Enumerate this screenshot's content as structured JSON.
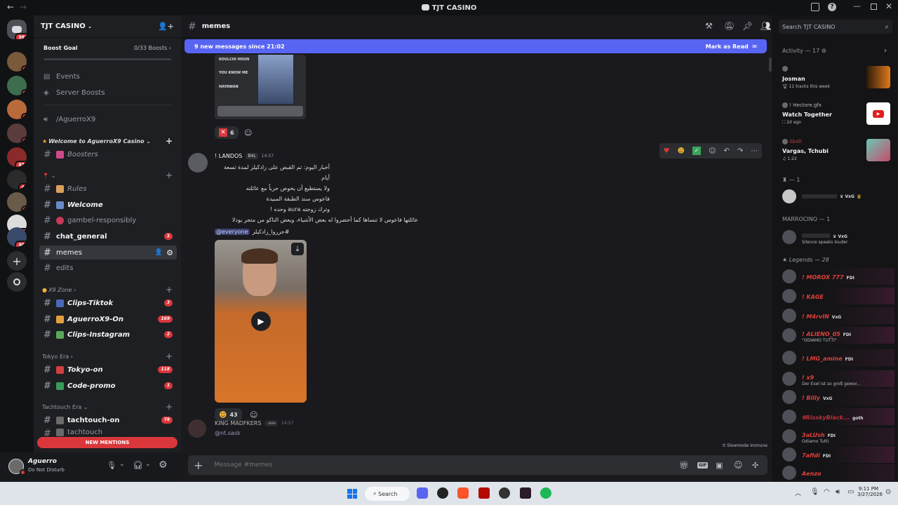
{
  "window": {
    "title": "TJT CASINO"
  },
  "guilds": [
    {
      "badge": "993",
      "color": "#4e5058"
    },
    {
      "badge": "1",
      "color": "#7a5a3a"
    },
    {
      "badge": "1",
      "color": "#3c6e4e"
    },
    {
      "badge": "2",
      "color": "#b86a3a"
    },
    {
      "badge": "3",
      "color": "#5a3c3c"
    },
    {
      "badge": "879",
      "color": "#8a2a2a"
    },
    {
      "badge": "43",
      "color": "#2a2a2a"
    },
    {
      "badge": "1",
      "color": "#6a5a4a"
    },
    {
      "badge": "411",
      "color": "#dcdcdc"
    },
    {
      "badge": "405",
      "color": "#3a4a6a"
    }
  ],
  "server": {
    "name": "TJT CASINO",
    "boost_goal": "Boost Goal",
    "boost_count": "0/33 Boosts"
  },
  "channels": {
    "events": "Events",
    "server_boosts": "Server Boosts",
    "voice": "/AguerroX9",
    "cat_welcome": "Welcome to AguerroX9 Casino",
    "boosters": "Boosters",
    "cat_small": "",
    "rules": "Rules",
    "welcome": "Welcome",
    "gambel": "gambel-responsibly",
    "chat_general": "chat_general",
    "chat_general_badge": "2",
    "memes": "memes",
    "edits": "edits",
    "cat_x9": "X9 Zone",
    "clips_tiktok": "Clips-Tiktok",
    "clips_tiktok_badge": "3",
    "aguerro_on": "AguerroX9-On",
    "aguerro_on_badge": "169",
    "clips_insta": "Clips-Instagram",
    "clips_insta_badge": "2",
    "cat_tokyo": "Tokyo Era",
    "tokyo_on": "Tokyo-on",
    "tokyo_on_badge": "118",
    "code_promo": "Code-promo",
    "code_promo_badge": "1",
    "cat_tacht": "Tachtouch Era",
    "tachtouch_on": "tachtouch-on",
    "tachtouch_on_badge": "78",
    "tachtouch": "tachtouch",
    "new_mentions": "NEW MENTIONS"
  },
  "user": {
    "name": "Aguerro",
    "status": "Do Not Disturb"
  },
  "chat": {
    "channel": "memes",
    "new_messages": "9 new messages since 21:02",
    "mark_read": "Mark as Read",
    "embed_lines": [
      "KOULCHI HOUN",
      "YOU KNOW ME",
      "HAYAWAN"
    ],
    "reaction1_count": "6",
    "msg1": {
      "author": "! LANDOS",
      "tag": "B4L",
      "time": "14:57",
      "lines": [
        "أخبار اليوم: تم القبض على زادكيلر لمدة تسعة أيام",
        "ولا يستطيع أن يخوض حرباً مع عائلته",
        "فاعوس سند الطبقة المبيدة",
        "وترك زوجته aura وحده !",
        "عائلتها فاعوس لا تنساها كما أحضروا له بعض الأشياء، ويعض الناكو من متجر يودلا"
      ],
      "mention": "@everyone",
      "hashtag": "#حرروا_زادكيلر",
      "reaction_count": "43"
    },
    "msg2": {
      "author": "KING MADFKERS",
      "tag": ".exe",
      "time": "14:57",
      "text": "@nt.sask"
    },
    "slowmode": "Slowmode Immune",
    "placeholder": "Message #memes"
  },
  "search": {
    "placeholder": "Search TJT CASINO"
  },
  "activity": {
    "header": "Activity — 17",
    "items": [
      {
        "name": "Josman",
        "sub": "11 tracks this week"
      },
      {
        "user": "! Hectore.gfx",
        "name": "Watch Together",
        "sub": "2d ago"
      },
      {
        "user": "Sb4ll",
        "name": "Vargas, Tchubi",
        "sub": "1:22"
      }
    ]
  },
  "members": {
    "group1": "— 1",
    "group1_member": {
      "tag": "VxG"
    },
    "group2": "MARROCINO — 1",
    "group2_member": {
      "tag": "VxG",
      "sub": "Silence speaks louder"
    },
    "group3": "Legends — 28",
    "list": [
      {
        "name": "! MOROX 777",
        "tag": "FDI",
        "color": "#e0403a",
        "sub": ""
      },
      {
        "name": "! KAGE",
        "tag": "",
        "color": "#e0403a",
        "sub": ""
      },
      {
        "name": "! M4rvIN",
        "tag": "VxG",
        "color": "#e0403a",
        "sub": ""
      },
      {
        "name": "! ALIENO_05",
        "tag": "FDI",
        "color": "#e0403a",
        "sub": "\"ODIAMO TUTTI\""
      },
      {
        "name": "! LMG_amine",
        "tag": "FDI",
        "color": "#e0403a",
        "sub": ""
      },
      {
        "name": "! x9",
        "tag": "",
        "color": "#e0403a",
        "sub": "Der Esel ist so groß gewor..."
      },
      {
        "name": "! Billy",
        "tag": "VxG",
        "color": "#e0403a",
        "sub": ""
      },
      {
        "name": "#RisskyBlack...",
        "tag": "goth",
        "color": "#c0303a",
        "sub": ""
      },
      {
        "name": "3aLUsh",
        "tag": "FDI",
        "color": "#e0403a",
        "sub": "Odiamo Tutti"
      },
      {
        "name": "7afidi",
        "tag": "FDI",
        "color": "#e0403a",
        "sub": ""
      },
      {
        "name": "Aenzo",
        "tag": "",
        "color": "#e0403a",
        "sub": ""
      }
    ]
  },
  "taskbar": {
    "search": "Search",
    "time": "9:11 PM",
    "date": "3/27/2026"
  }
}
